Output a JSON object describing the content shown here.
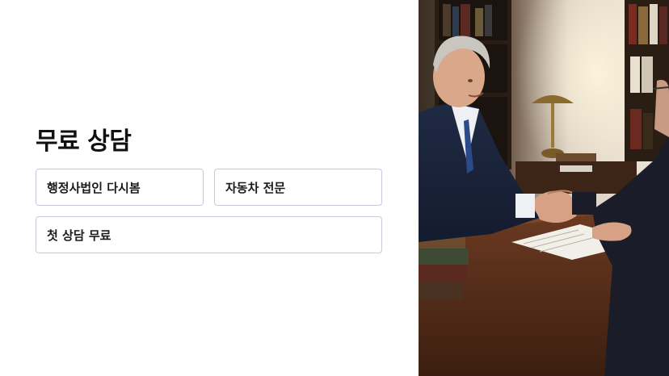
{
  "title": "무료 상담",
  "tags": [
    {
      "label": "행정사법인 다시봄"
    },
    {
      "label": "자동차 전문"
    },
    {
      "label": "첫 상담 무료"
    }
  ],
  "photo": {
    "icon": "handshake-consultation-photo"
  }
}
